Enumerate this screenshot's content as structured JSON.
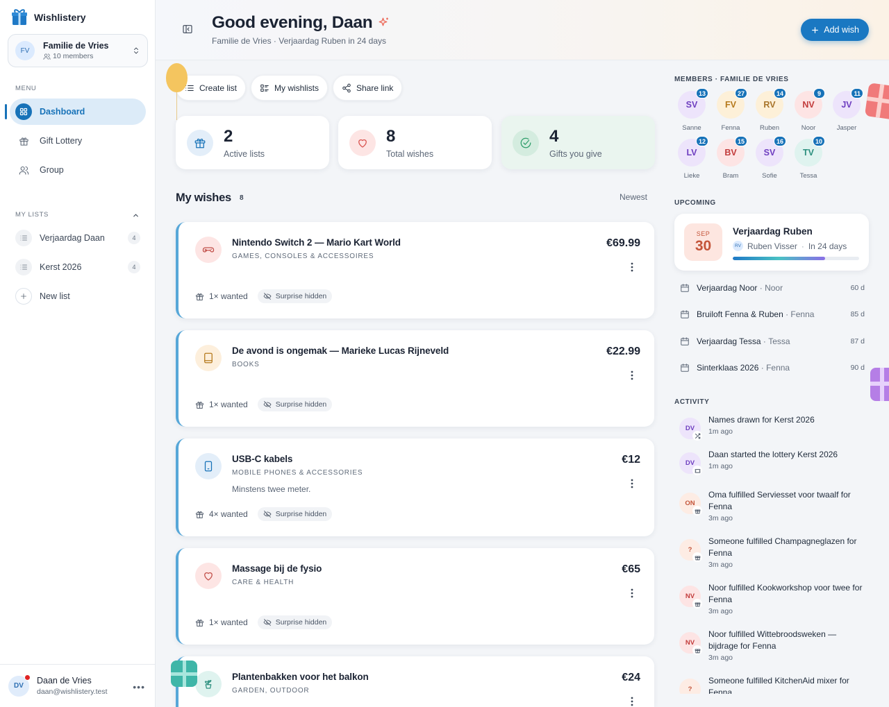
{
  "app": {
    "name": "Wishlistery"
  },
  "group": {
    "initials": "FV",
    "name": "Familie de Vries",
    "members": "10 members"
  },
  "sidebar": {
    "menu_label": "MENU",
    "nav": [
      {
        "label": "Dashboard",
        "icon": "dashboard-icon",
        "active": true
      },
      {
        "label": "Gift Lottery",
        "icon": "gift-icon"
      },
      {
        "label": "Group",
        "icon": "users-icon"
      }
    ],
    "lists_label": "MY LISTS",
    "lists": [
      {
        "label": "Verjaardag Daan",
        "count": "4"
      },
      {
        "label": "Kerst 2026",
        "count": "4"
      }
    ],
    "new_list": "New list"
  },
  "user": {
    "initials": "DV",
    "name": "Daan de Vries",
    "email": "daan@wishlistery.test"
  },
  "header": {
    "greeting": "Good evening, Daan",
    "subtitle": "Familie de Vries · Verjaardag Ruben in 24 days",
    "add_button": "Add wish"
  },
  "actions": {
    "create": "Create list",
    "wishlists": "My wishlists",
    "share": "Share link"
  },
  "stats": [
    {
      "value": "2",
      "label": "Active lists",
      "color": "#1772b8"
    },
    {
      "value": "8",
      "label": "Total wishes",
      "color": "#d9534f"
    },
    {
      "value": "4",
      "label": "Gifts you give",
      "color": "#2f9e6b"
    }
  ],
  "wishes": {
    "title": "My wishes",
    "count": "8",
    "sort": "Newest",
    "items": [
      {
        "title": "Nintendo Switch 2 — Mario Kart World",
        "category": "GAMES, CONSOLES & ACCESSOIRES",
        "note": "",
        "price": "€69.99",
        "wanted": "1× wanted",
        "chip": "Surprise hidden",
        "icon": "gamepad-icon"
      },
      {
        "title": "De avond is ongemak — Marieke Lucas Rijneveld",
        "category": "BOOKS",
        "note": "",
        "price": "€22.99",
        "wanted": "1× wanted",
        "chip": "Surprise hidden",
        "icon": "book-icon"
      },
      {
        "title": "USB-C kabels",
        "category": "MOBILE PHONES & ACCESSORIES",
        "note": "Minstens twee meter.",
        "price": "€12",
        "wanted": "4× wanted",
        "chip": "Surprise hidden",
        "icon": "phone-icon"
      },
      {
        "title": "Massage bij de fysio",
        "category": "CARE & HEALTH",
        "note": "",
        "price": "€65",
        "wanted": "1× wanted",
        "chip": "Surprise hidden",
        "icon": "heart-icon"
      },
      {
        "title": "Plantenbakken voor het balkon",
        "category": "GARDEN, OUTDOOR",
        "note": "",
        "price": "€24",
        "wanted": "",
        "chip": "",
        "icon": "plant-icon"
      }
    ]
  },
  "members": {
    "label": "MEMBERS · FAMILIE DE VRIES",
    "list": [
      {
        "initials": "SV",
        "name": "Sanne",
        "count": "13",
        "bg": "#ede4fb",
        "fg": "#6f3fc0"
      },
      {
        "initials": "FV",
        "name": "Fenna",
        "count": "27",
        "bg": "#fdf0d8",
        "fg": "#b5791c"
      },
      {
        "initials": "RV",
        "name": "Ruben",
        "count": "14",
        "bg": "#fdf0d8",
        "fg": "#a8742a"
      },
      {
        "initials": "NV",
        "name": "Noor",
        "count": "9",
        "bg": "#fde4e4",
        "fg": "#c23b3b"
      },
      {
        "initials": "JV",
        "name": "Jasper",
        "count": "11",
        "bg": "#ede4fb",
        "fg": "#6f3fc0"
      },
      {
        "initials": "LV",
        "name": "Lieke",
        "count": "12",
        "bg": "#ede4fb",
        "fg": "#6f3fc0"
      },
      {
        "initials": "BV",
        "name": "Bram",
        "count": "15",
        "bg": "#fde4e4",
        "fg": "#c23b3b"
      },
      {
        "initials": "SV",
        "name": "Sofie",
        "count": "16",
        "bg": "#ede4fb",
        "fg": "#6f3fc0"
      },
      {
        "initials": "TV",
        "name": "Tessa",
        "count": "10",
        "bg": "#dff3ef",
        "fg": "#2b8f7e"
      }
    ]
  },
  "upcoming": {
    "label": "UPCOMING",
    "featured": {
      "month": "SEP",
      "day": "30",
      "title": "Verjaardag Ruben",
      "person_initials": "RV",
      "person": "Ruben Visser",
      "when": "In 24 days",
      "progress": 0.73
    },
    "events": [
      {
        "title": "Verjaardag Noor",
        "who": "Noor",
        "days": "60 d"
      },
      {
        "title": "Bruiloft Fenna & Ruben",
        "who": "Fenna",
        "days": "85 d"
      },
      {
        "title": "Verjaardag Tessa",
        "who": "Tessa",
        "days": "87 d"
      },
      {
        "title": "Sinterklaas 2026",
        "who": "Fenna",
        "days": "90 d"
      }
    ]
  },
  "activity": {
    "label": "ACTIVITY",
    "items": [
      {
        "initials": "DV",
        "text": "Names drawn for Kerst 2026",
        "time": "1m ago",
        "bg": "#ede4fb",
        "fg": "#6f3fc0",
        "icon": "shuffle-icon"
      },
      {
        "initials": "DV",
        "text": "Daan started the lottery Kerst 2026",
        "time": "1m ago",
        "bg": "#ede4fb",
        "fg": "#6f3fc0",
        "icon": "ticket-icon"
      },
      {
        "initials": "ON",
        "text": "Oma fulfilled Serviesset voor twaalf for Fenna",
        "time": "3m ago",
        "bg": "#fdece4",
        "fg": "#c4553a",
        "icon": "gift-icon"
      },
      {
        "initials": "?",
        "text": "Someone fulfilled Champagneglazen for Fenna",
        "time": "3m ago",
        "bg": "#fdece4",
        "fg": "#c4553a",
        "icon": "gift-icon"
      },
      {
        "initials": "NV",
        "text": "Noor fulfilled Kookworkshop voor twee for Fenna",
        "time": "3m ago",
        "bg": "#fde4e4",
        "fg": "#c23b3b",
        "icon": "gift-icon"
      },
      {
        "initials": "NV",
        "text": "Noor fulfilled Wittebroodsweken — bijdrage for Fenna",
        "time": "3m ago",
        "bg": "#fde4e4",
        "fg": "#c23b3b",
        "icon": "gift-icon"
      },
      {
        "initials": "?",
        "text": "Someone fulfilled KitchenAid mixer for Fenna",
        "time": "",
        "bg": "#fdece4",
        "fg": "#c4553a",
        "icon": "gift-icon"
      }
    ]
  }
}
